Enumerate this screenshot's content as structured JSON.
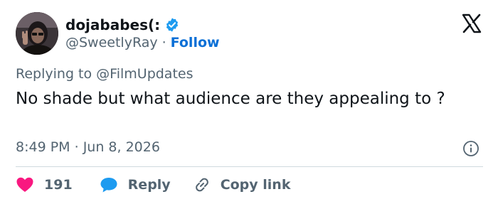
{
  "author": {
    "display_name": "dojababes(:",
    "handle": "@SweetlyRay",
    "separator": "·",
    "follow_label": "Follow"
  },
  "reply_context": {
    "prefix": "Replying to",
    "mention": "@FilmUpdates"
  },
  "tweet": {
    "text": "No shade but what audience are they appealing to ?"
  },
  "meta": {
    "time": "8:49 PM",
    "separator": "·",
    "date": "Jun 8, 2026"
  },
  "actions": {
    "like_count": "191",
    "reply_label": "Reply",
    "copy_link_label": "Copy link"
  },
  "colors": {
    "like": "#f91880",
    "reply": "#1d9bf0",
    "follow": "#0a6fd6",
    "verified": "#1d9bf0",
    "muted": "#536471",
    "text": "#0f1419",
    "divider": "#cfd9de"
  },
  "icons": {
    "verified": "verified-badge-icon",
    "brand": "x-logo-icon",
    "info": "info-icon",
    "like": "heart-icon",
    "reply": "speech-bubble-icon",
    "copy_link": "link-icon"
  }
}
